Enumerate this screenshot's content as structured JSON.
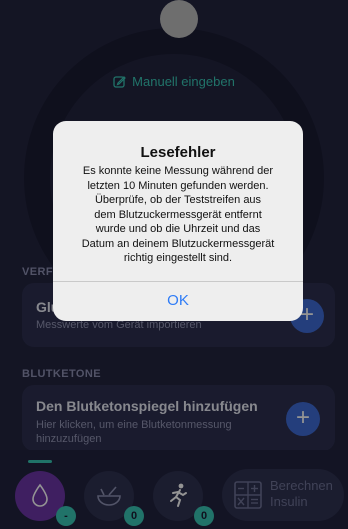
{
  "manual_entry": {
    "label": "Manuell eingeben",
    "icon": "pencil-square-icon"
  },
  "sections": {
    "glucose_label": "VERF",
    "glucose_card_title": "Glu",
    "glucose_card_sub": "Messwerte vom Gerät importieren",
    "ketone_label": "BLUTKETONE",
    "ketone_card_title": "Den Blutketonspiegel hinzufügen",
    "ketone_card_sub_1": "Hier klicken, um eine Blutketonmessung",
    "ketone_card_sub_2": "hinzuzufügen",
    "plus_glyph": "+"
  },
  "bottom_nav": {
    "items": [
      {
        "icon": "drop-icon",
        "badge": "-"
      },
      {
        "icon": "bowl-icon",
        "badge": "0"
      },
      {
        "icon": "running-icon",
        "badge": "0"
      }
    ],
    "calc_label_1": "Berechnen",
    "calc_label_2": "Insulin",
    "calc_icon": "calculator-icon"
  },
  "alert": {
    "title": "Lesefehler",
    "message_lines": [
      "Es konnte keine Messung während der",
      "letzten 10 Minuten gefunden werden.",
      "Überprüfe, ob der Teststreifen aus",
      "dem Blutzuckermessgerät entfernt",
      "wurde und ob die Uhrzeit und das",
      "Datum an deinem Blutzuckermessgerät",
      "richtig eingestellt sind."
    ],
    "ok_label": "OK"
  },
  "colors": {
    "background": "#23253f",
    "accent_teal": "#39c6b6",
    "plus_blue": "#3f6bd6",
    "active_purple": "#6d36a8",
    "alert_button": "#2f7cf6"
  }
}
